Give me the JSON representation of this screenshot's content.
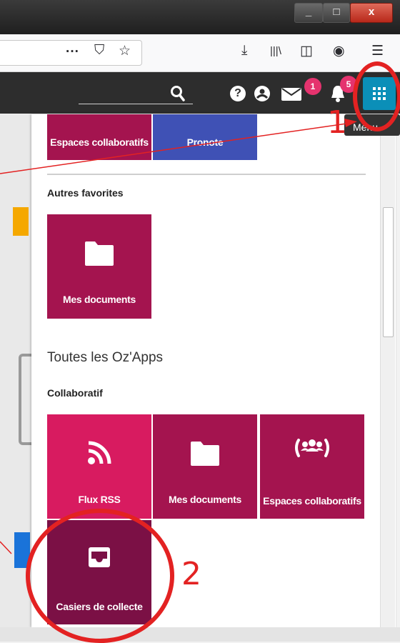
{
  "browser": {
    "window_controls": [
      "_",
      "□",
      "x"
    ],
    "toolbar_icons": [
      "more-actions-icon",
      "pocket-icon",
      "bookmark-star-icon",
      "download-icon",
      "library-icon",
      "sidebar-icon",
      "account-icon",
      "menu-icon"
    ],
    "toolbar_glyphs": {
      "more": "···",
      "pocket": "⛉",
      "star": "☆",
      "download": "⤓",
      "library": "|||\\",
      "sidebar": "◫",
      "account": "◉",
      "menu": "☰"
    }
  },
  "header": {
    "search_icon": "search-icon",
    "help_glyph": "?",
    "mail_badge": "1",
    "notif_badge": "5",
    "apps_icon": "apps-grid-icon",
    "tooltip": "Menu"
  },
  "panel": {
    "top_tiles": [
      {
        "label": "Espaces collaboratifs",
        "color": "#a4144f"
      },
      {
        "label": "Pronote",
        "color": "#3f51b5"
      }
    ],
    "favorites_heading": "Autres favorites",
    "favorite_tiles": [
      {
        "label": "Mes documents",
        "icon": "folder-icon",
        "color": "#a4144f"
      }
    ],
    "apps_title": "Toutes les Oz'Apps",
    "category_heading": "Collaboratif",
    "collab_tiles": [
      {
        "label": "Flux RSS",
        "icon": "rss-icon",
        "color": "#d81b60"
      },
      {
        "label": "Mes documents",
        "icon": "folder-icon",
        "color": "#a4144f"
      },
      {
        "label": "Espaces collaboratifs",
        "icon": "group-icon",
        "color": "#a4144f"
      },
      {
        "label": "Casiers de collecte",
        "icon": "inbox-icon",
        "color": "#7b1045"
      }
    ]
  },
  "annotations": {
    "step1": "1",
    "step2": "2",
    "color": "#e32222"
  }
}
